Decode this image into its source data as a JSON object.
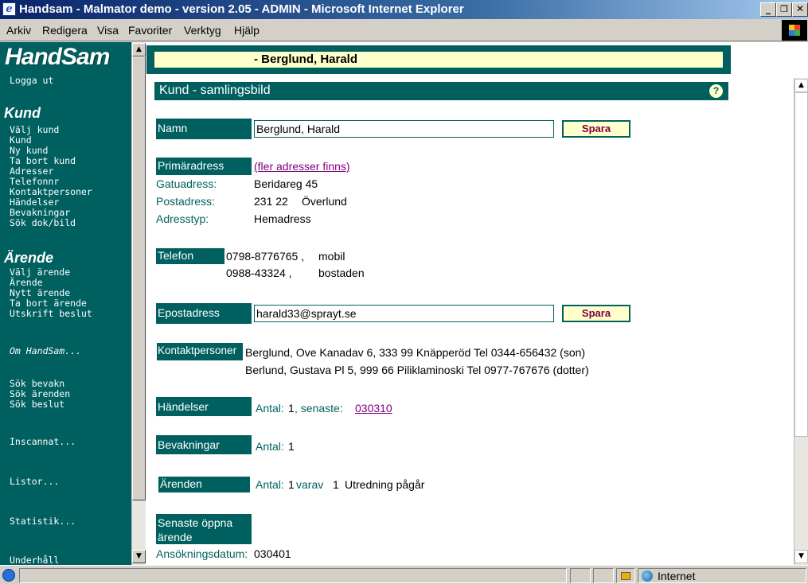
{
  "window": {
    "title": "Handsam - Malmator demo - version 2.05 - ADMIN - Microsoft Internet Explorer",
    "minimize": "_",
    "restore": "❐",
    "close": "✕"
  },
  "menu": [
    "Arkiv",
    "Redigera",
    "Visa",
    "Favoriter",
    "Verktyg",
    "Hjälp"
  ],
  "nav": {
    "brand": "HandSam",
    "logout": "Logga ut",
    "kund_heading": "Kund",
    "kund_items": [
      "Välj kund",
      "Kund",
      "Ny kund",
      "Ta bort kund",
      "Adresser",
      "Telefonnr",
      "Kontaktpersoner",
      "Händelser",
      "Bevakningar",
      "Sök dok/bild"
    ],
    "arende_heading": "Ärende",
    "arende_items": [
      "Välj ärende",
      "Ärende",
      "Nytt ärende",
      "Ta bort ärende",
      "Utskrift beslut"
    ],
    "om": "Om HandSam...",
    "sok_items": [
      "Sök bevakn",
      "Sök ärenden",
      "Sök beslut"
    ],
    "inscannat": "Inscannat...",
    "listor": "Listor...",
    "statistik": "Statistik...",
    "underhall": "Underhåll"
  },
  "header": {
    "customer": "- Berglund, Harald"
  },
  "section": {
    "title": "Kund - samlingsbild",
    "help": "?"
  },
  "namn": {
    "label": "Namn",
    "value": "Berglund, Harald",
    "save": "Spara"
  },
  "address": {
    "label": "Primäradress",
    "more_link": "(fler adresser finns)",
    "street_label": "Gatuadress:",
    "street": "Beridareg 45",
    "postal_label": "Postadress:",
    "postcode": "231 22",
    "city": "Överlund",
    "type_label": "Adresstyp:",
    "type": "Hemadress"
  },
  "telefon": {
    "label": "Telefon",
    "rows": [
      {
        "number": "0798-8776765 ,",
        "type": "mobil"
      },
      {
        "number": "0988-43324 ,",
        "type": "bostaden"
      }
    ]
  },
  "epost": {
    "label": "Epostadress",
    "value": "harald33@sprayt.se",
    "save": "Spara"
  },
  "kontakt": {
    "label": "Kontaktpersoner",
    "rows": [
      "Berglund, Ove Kanadav 6, 333 99 Knäpperöd Tel 0344-656432 (son)",
      "Berlund, Gustava Pl 5, 999 66 Piliklaminoski Tel 0977-767676 (dotter)"
    ]
  },
  "handelser": {
    "label": "Händelser",
    "antal_label": "Antal:",
    "antal": "1",
    "senaste_label": ", senaste:",
    "senaste": "030310"
  },
  "bevakningar": {
    "label": "Bevakningar",
    "antal_label": "Antal:",
    "antal": "1"
  },
  "arenden": {
    "label": "Ärenden",
    "antal_label": "Antal:",
    "antal": "1",
    "varav_label": "varav",
    "varav": "1",
    "status": "Utredning pågår"
  },
  "senaste": {
    "label": "Senaste öppna ärende",
    "datum_label": "Ansökningsdatum:",
    "datum": "030401"
  },
  "status": {
    "zone": "Internet"
  }
}
